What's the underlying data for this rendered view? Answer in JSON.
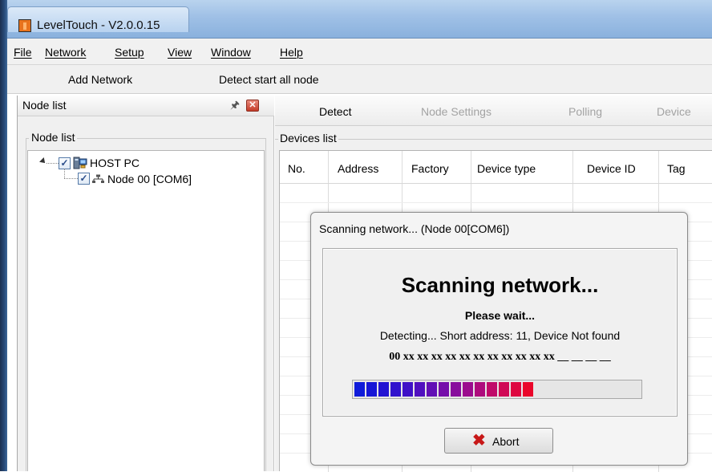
{
  "window": {
    "title": "LevelTouch - V2.0.0.15",
    "app_icon": "leveltouch-app-icon"
  },
  "menubar": {
    "items": [
      {
        "label": "File",
        "mnemonic_index": 0
      },
      {
        "label": "Network",
        "mnemonic_index": 0
      },
      {
        "label": "Setup",
        "mnemonic_index": 0
      },
      {
        "label": "View",
        "mnemonic_index": 0
      },
      {
        "label": "Window",
        "mnemonic_index": 0
      },
      {
        "label": "Help",
        "mnemonic_index": 0
      }
    ]
  },
  "toolbar": {
    "add_network": "Add Network",
    "detect_all": "Detect start all node"
  },
  "node_panel": {
    "title": "Node list",
    "group_label": "Node list",
    "tree": [
      {
        "label": "HOST PC",
        "checked": true,
        "icon": "host-pc-icon"
      },
      {
        "label": "Node 00 [COM6]",
        "checked": true,
        "icon": "network-node-icon"
      }
    ]
  },
  "tabs": [
    {
      "label": "Detect",
      "enabled": true
    },
    {
      "label": "Node Settings",
      "enabled": false
    },
    {
      "label": "Polling",
      "enabled": false
    },
    {
      "label": "Device",
      "enabled": false
    }
  ],
  "devices": {
    "group_label": "Devices list",
    "columns": [
      "No.",
      "Address",
      "Factory",
      "Device type",
      "Device ID",
      "Tag"
    ],
    "rows": []
  },
  "dialog": {
    "title": "Scanning network... (Node 00[COM6])",
    "heading": "Scanning network...",
    "wait": "Please wait...",
    "status": "Detecting...  Short address: 11, Device Not found",
    "address_progress": "00 xx xx xx xx xx xx xx xx xx xx xx __ __ __ __",
    "progress_fraction": 0.75,
    "progress_segments_total": 20,
    "progress_segments_filled": 15,
    "progress_colors": [
      "#0f1bd9",
      "#1616d6",
      "#2213d2",
      "#3012cd",
      "#3f11c7",
      "#5010bf",
      "#620fb5",
      "#750eaa",
      "#880d9d",
      "#9b0c8e",
      "#ae0b7d",
      "#c00a6a",
      "#d00956",
      "#de0740",
      "#ea062a"
    ],
    "abort_label": "Abort",
    "abort_icon": "red-x-icon"
  }
}
